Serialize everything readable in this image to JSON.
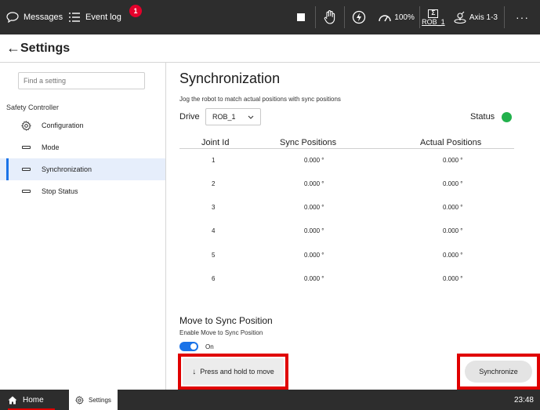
{
  "topbar": {
    "messages_label": "Messages",
    "event_log_label": "Event log",
    "event_log_badge": "1",
    "speed_label": "100%",
    "robot_label": "ROB_1",
    "axis_label": "Axis 1-3",
    "more_label": "···"
  },
  "titlebar": {
    "back_icon": "arrow-left-icon",
    "title": "Settings"
  },
  "sidebar": {
    "search_placeholder": "Find a setting",
    "section_label": "Safety Controller",
    "items": [
      {
        "label": "Configuration",
        "icon": "gear-icon",
        "active": false
      },
      {
        "label": "Mode",
        "icon": "rectangle-icon",
        "active": false
      },
      {
        "label": "Synchronization",
        "icon": "rectangle-icon",
        "active": true
      },
      {
        "label": "Stop Status",
        "icon": "rectangle-icon",
        "active": false
      }
    ]
  },
  "main": {
    "title": "Synchronization",
    "subtitle": "Jog the robot to match actual positions with sync positions",
    "drive_label": "Drive",
    "drive_value": "ROB_1",
    "status_label": "Status",
    "status_color": "#22b14c",
    "table": {
      "headers": [
        "Joint Id",
        "Sync Positions",
        "Actual Positions"
      ],
      "rows": [
        [
          "1",
          "0.000 °",
          "0.000 °"
        ],
        [
          "2",
          "0.000 °",
          "0.000 °"
        ],
        [
          "3",
          "0.000 °",
          "0.000 °"
        ],
        [
          "4",
          "0.000 °",
          "0.000 °"
        ],
        [
          "5",
          "0.000 °",
          "0.000 °"
        ],
        [
          "6",
          "0.000 °",
          "0.000 °"
        ]
      ]
    },
    "move_title": "Move to Sync Position",
    "move_subtitle": "Enable Move to Sync Position",
    "toggle_label": "On",
    "toggle_on": true,
    "press_button_label": "Press and hold to move",
    "sync_button_label": "Synchronize",
    "highlight_color": "#e00000"
  },
  "bottombar": {
    "home_label": "Home",
    "settings_label": "Settings",
    "time": "23:48"
  }
}
